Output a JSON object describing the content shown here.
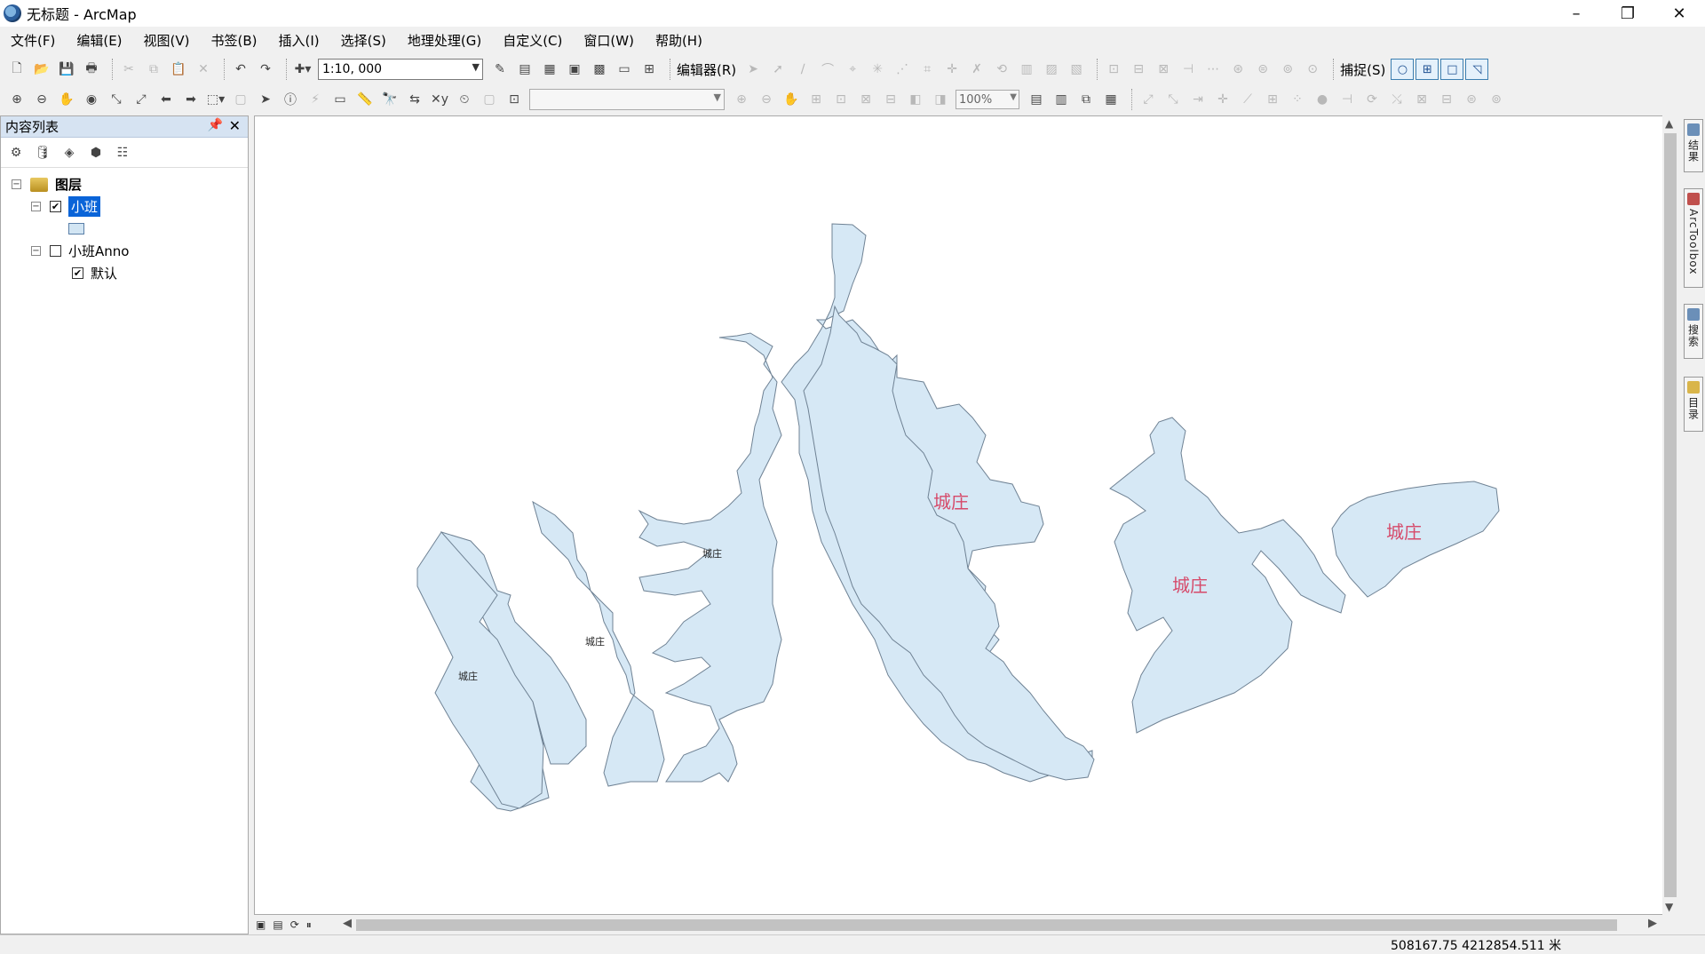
{
  "window": {
    "title": "无标题 - ArcMap"
  },
  "menu": [
    "文件(F)",
    "编辑(E)",
    "视图(V)",
    "书签(B)",
    "插入(I)",
    "选择(S)",
    "地理处理(G)",
    "自定义(C)",
    "窗口(W)",
    "帮助(H)"
  ],
  "toolbar": {
    "scale_value": "1:10, 000",
    "editor_label": "编辑器(R)",
    "snapping_label": "捕捉(S)",
    "zoom_percent": "100%"
  },
  "toc": {
    "title": "内容列表",
    "root": "图层",
    "layer1": {
      "name": "小班",
      "checked": true
    },
    "layer2": {
      "name": "小班Anno",
      "checked": false
    },
    "layer2_sub": {
      "name": "默认",
      "checked": true
    }
  },
  "map": {
    "fill_color": "#d6e8f5",
    "stroke_color": "#6f8294",
    "labels": [
      {
        "text": "城庄",
        "style": "small"
      },
      {
        "text": "城庄",
        "style": "small"
      },
      {
        "text": "城庄",
        "style": "small"
      },
      {
        "text": "城庄",
        "style": "red"
      },
      {
        "text": "城庄",
        "style": "red"
      },
      {
        "text": "城庄",
        "style": "red"
      }
    ]
  },
  "dock": [
    "结果",
    "ArcToolbox",
    "搜索",
    "目录"
  ],
  "status": {
    "coords": "508167.75  4212854.511 米"
  }
}
